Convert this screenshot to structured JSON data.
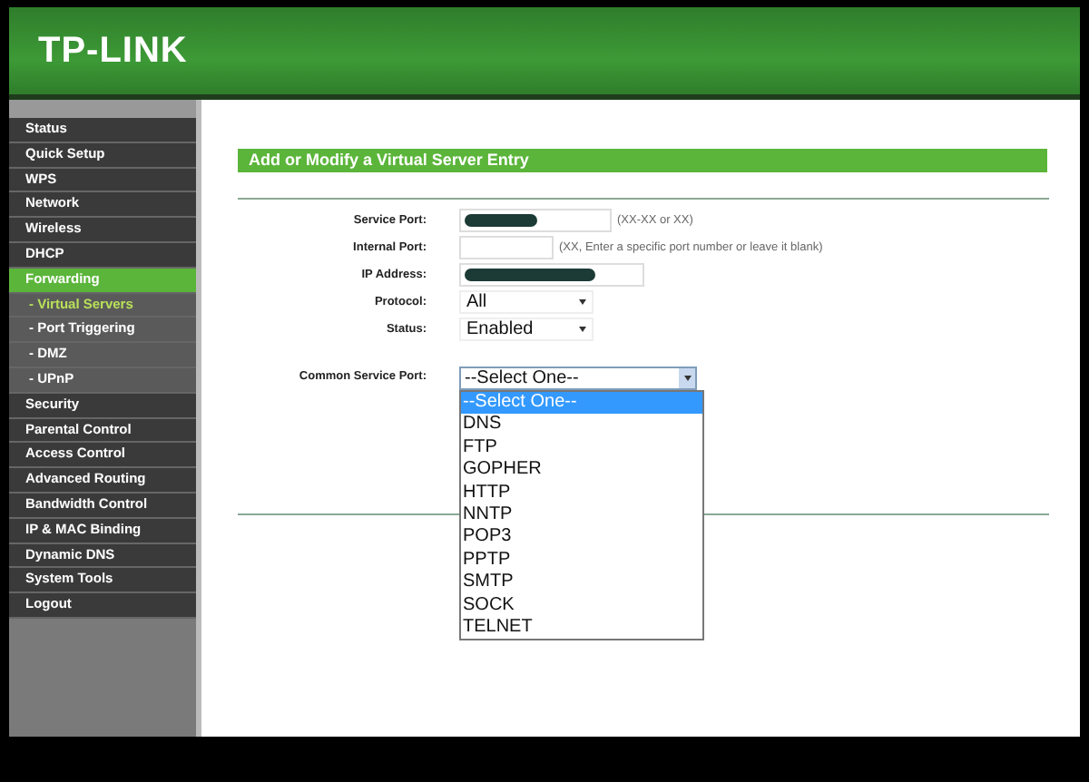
{
  "header": {
    "logo": "TP-LINK"
  },
  "sidebar": {
    "items": [
      {
        "label": "Status",
        "kind": "main",
        "selected": false
      },
      {
        "label": "Quick Setup",
        "kind": "main",
        "selected": false
      },
      {
        "label": "WPS",
        "kind": "main",
        "selected": false
      },
      {
        "label": "Network",
        "kind": "main",
        "selected": false
      },
      {
        "label": "Wireless",
        "kind": "main",
        "selected": false
      },
      {
        "label": "DHCP",
        "kind": "main",
        "selected": false
      },
      {
        "label": "Forwarding",
        "kind": "main",
        "selected": true
      },
      {
        "label": "- Virtual Servers",
        "kind": "sub",
        "selected": true
      },
      {
        "label": "- Port Triggering",
        "kind": "sub",
        "selected": false
      },
      {
        "label": "- DMZ",
        "kind": "sub",
        "selected": false
      },
      {
        "label": "- UPnP",
        "kind": "sub",
        "selected": false
      },
      {
        "label": "Security",
        "kind": "main",
        "selected": false
      },
      {
        "label": "Parental Control",
        "kind": "main",
        "selected": false
      },
      {
        "label": "Access Control",
        "kind": "main",
        "selected": false
      },
      {
        "label": "Advanced Routing",
        "kind": "main",
        "selected": false
      },
      {
        "label": "Bandwidth Control",
        "kind": "main",
        "selected": false
      },
      {
        "label": "IP & MAC Binding",
        "kind": "main",
        "selected": false
      },
      {
        "label": "Dynamic DNS",
        "kind": "main",
        "selected": false
      },
      {
        "label": "System Tools",
        "kind": "main",
        "selected": false
      },
      {
        "label": "Logout",
        "kind": "main",
        "selected": false
      }
    ]
  },
  "form": {
    "title": "Add or Modify a Virtual Server Entry",
    "fields": [
      {
        "label": "Service Port:",
        "kind": "input",
        "redacted": true,
        "hint": "(XX-XX or XX)"
      },
      {
        "label": "Internal Port:",
        "kind": "input",
        "redacted": false,
        "hint": "(XX, Enter a specific port number or leave it blank)"
      },
      {
        "label": "IP Address:",
        "kind": "input",
        "redacted": true
      },
      {
        "label": "Protocol:",
        "kind": "select",
        "value": "All"
      },
      {
        "label": "Status:",
        "kind": "select",
        "value": "Enabled"
      }
    ],
    "common_service_port": {
      "label": "Common Service Port:",
      "value": "--Select One--",
      "expanded": true,
      "options": [
        {
          "label": "--Select One--",
          "selected": true
        },
        {
          "label": "DNS",
          "selected": false
        },
        {
          "label": "FTP",
          "selected": false
        },
        {
          "label": "GOPHER",
          "selected": false
        },
        {
          "label": "HTTP",
          "selected": false
        },
        {
          "label": "NNTP",
          "selected": false
        },
        {
          "label": "POP3",
          "selected": false
        },
        {
          "label": "PPTP",
          "selected": false
        },
        {
          "label": "SMTP",
          "selected": false
        },
        {
          "label": "SOCK",
          "selected": false
        },
        {
          "label": "TELNET",
          "selected": false
        }
      ]
    }
  }
}
